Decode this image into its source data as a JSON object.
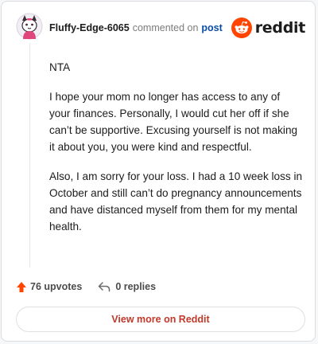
{
  "header": {
    "username": "Fluffy-Edge-6065",
    "action_text": "commented on",
    "post_link": "post",
    "brand": "reddit"
  },
  "comment": {
    "paragraphs": [
      "NTA",
      "I hope your mom no longer has access to any of your finances. Personally, I would cut her off if she can’t be supportive. Excusing yourself is not making it about you, you were kind and respectful.",
      "Also, I am sorry for your loss. I had a 10 week loss in October and still can’t do pregnancy announcements and have distanced myself from them for my mental health."
    ]
  },
  "footer": {
    "upvotes": "76 upvotes",
    "replies": "0 replies",
    "view_more": "View more on Reddit"
  },
  "icons": {
    "upvote": "upvote-arrow-icon",
    "reply": "reply-arrow-icon",
    "brand": "reddit-snoo-icon",
    "avatar": "user-avatar"
  },
  "colors": {
    "accent": "#ff4500",
    "link": "#0a4da8",
    "view_more": "#c0392b"
  }
}
